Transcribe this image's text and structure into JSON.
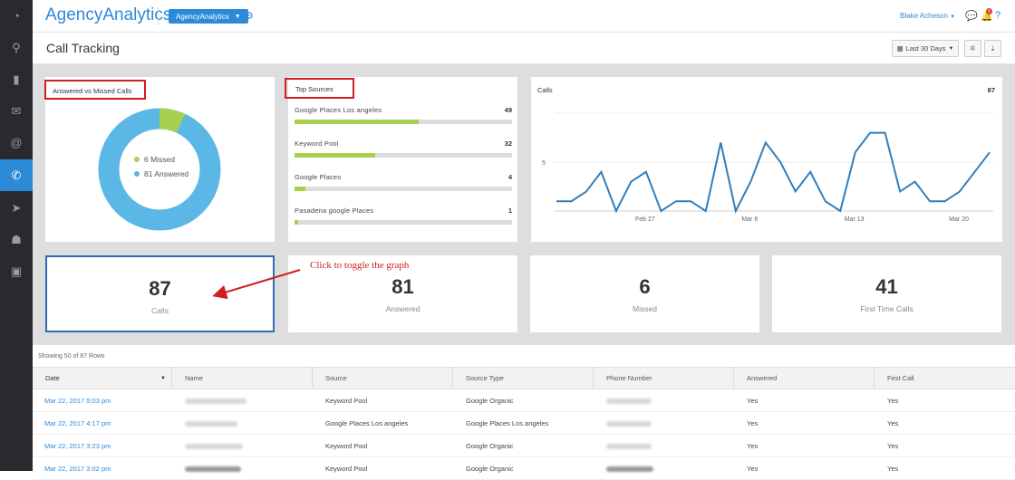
{
  "sidebar": {
    "items": [
      {
        "icon": "dashboard-icon",
        "glyph": "◔"
      },
      {
        "icon": "search-icon",
        "glyph": "⚲"
      },
      {
        "icon": "bar-chart-icon",
        "glyph": "▮"
      },
      {
        "icon": "chat-icon",
        "glyph": "✉"
      },
      {
        "icon": "at-icon",
        "glyph": "@"
      },
      {
        "icon": "phone-icon",
        "glyph": "✆"
      },
      {
        "icon": "send-icon",
        "glyph": "➤"
      },
      {
        "icon": "user-icon",
        "glyph": "☗"
      },
      {
        "icon": "clipboard-icon",
        "glyph": "▣"
      }
    ]
  },
  "topbar": {
    "logo": "AgencyAnalytics",
    "agency_button": "AgencyAnalytics",
    "user_name": "Blake Acheson",
    "notification_count": "0"
  },
  "page": {
    "title": "Call Tracking",
    "date_range": "Last 30 Days"
  },
  "donut": {
    "title": "Answered vs Missed Calls",
    "legend": [
      {
        "label": "6 Missed",
        "value": 6,
        "color": "#a7d050"
      },
      {
        "label": "81 Answered",
        "value": 81,
        "color": "#5bb7e6"
      }
    ]
  },
  "top_sources": {
    "title": "Top Sources",
    "items": [
      {
        "name": "Google Places Los angeles",
        "value": "49",
        "fraction": 0.57
      },
      {
        "name": "Keyword Pool",
        "value": "32",
        "fraction": 0.37
      },
      {
        "name": "Google Places",
        "value": "4",
        "fraction": 0.05
      },
      {
        "name": "Pasadena google Places",
        "value": "1",
        "fraction": 0.015
      }
    ]
  },
  "chart_data": {
    "type": "line",
    "title": "Calls",
    "total": "87",
    "x_ticks": [
      "Feb 27",
      "Mar 6",
      "Mar 13",
      "Mar 20"
    ],
    "y_ticks": [
      "5"
    ],
    "ylim": [
      0,
      10
    ],
    "series": [
      {
        "values": [
          1,
          1,
          2,
          4,
          0,
          3,
          4,
          0,
          1,
          1,
          0,
          7,
          0,
          3,
          7,
          5,
          2,
          4,
          1,
          0,
          6,
          8,
          8,
          2,
          3,
          1,
          1,
          2,
          4,
          6
        ]
      }
    ]
  },
  "stats": [
    {
      "value": "87",
      "label": "Calls"
    },
    {
      "value": "81",
      "label": "Answered"
    },
    {
      "value": "6",
      "label": "Missed"
    },
    {
      "value": "41",
      "label": "First Time Calls"
    }
  ],
  "annotation": "Click to toggle the graph",
  "table": {
    "showing": "Showing 50 of 87 Rows",
    "headers": [
      "Date",
      "Name",
      "Source",
      "Source Type",
      "Phone Number",
      "Answered",
      "First Call"
    ],
    "rows": [
      {
        "date": "Mar 22, 2017 5:03 pm",
        "source": "Keyword Pool",
        "source_type": "Google Organic",
        "answered": "Yes",
        "first_call": "Yes"
      },
      {
        "date": "Mar 22, 2017 4:17 pm",
        "source": "Google Places Los angeles",
        "source_type": "Google Places Los angeles",
        "answered": "Yes",
        "first_call": "Yes"
      },
      {
        "date": "Mar 22, 2017 3:23 pm",
        "source": "Keyword Pool",
        "source_type": "Google Organic",
        "answered": "Yes",
        "first_call": "Yes"
      },
      {
        "date": "Mar 22, 2017 3:02 pm",
        "source": "Keyword Pool",
        "source_type": "Google Organic",
        "answered": "Yes",
        "first_call": "Yes"
      }
    ]
  }
}
